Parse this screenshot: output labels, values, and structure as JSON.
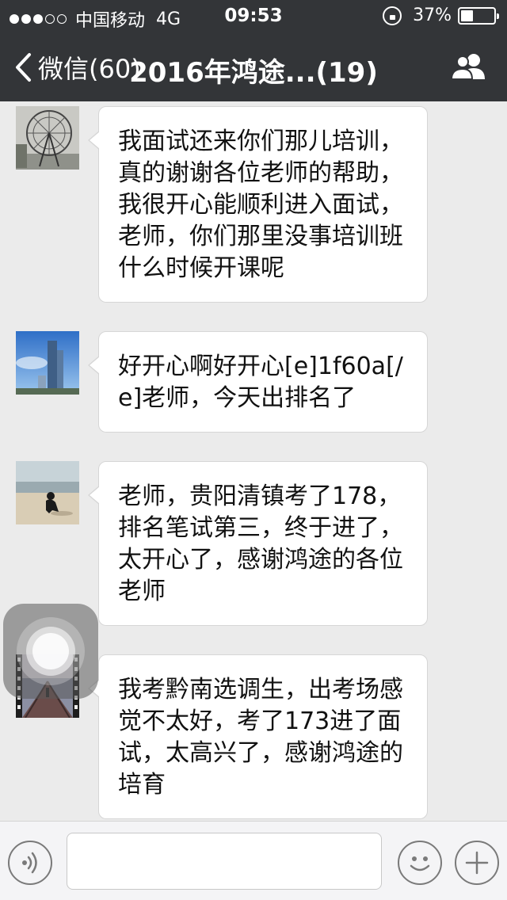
{
  "status_bar": {
    "carrier": "中国移动",
    "network": "4G",
    "time": "09:53",
    "battery": "37%",
    "battery_level": 0.37,
    "signal_bars_filled": 3,
    "signal_bars_total": 5
  },
  "nav": {
    "back_label": "微信(60)",
    "title": "2016年鸿途...(19)",
    "group_info_icon": "people-icon"
  },
  "messages": [
    {
      "avatar": "ferris-wheel-photo",
      "text": "我面试还来你们那儿培训，真的谢谢各位老师的帮助，我很开心能顺利进入面试，老师，你们那里没事培训班什么时候开课呢"
    },
    {
      "avatar": "skyscraper-photo",
      "text": "好开心啊好开心[e]1f60a[/e]老师，今天出排名了"
    },
    {
      "avatar": "beach-person-photo",
      "text": "老师，贵阳清镇考了178，排名笔试第三，终于进了，太开心了，感谢鸿途的各位老师"
    },
    {
      "avatar": "boardwalk-film-photo",
      "text": "我考黔南选调生，出考场感觉不太好，考了173进了面试，太高兴了，感谢鸿途的培育"
    }
  ],
  "input_bar": {
    "voice_icon": "voice-icon",
    "text_value": "",
    "emoji_icon": "emoji-icon",
    "more_icon": "plus-icon"
  },
  "colors": {
    "header_bg": "#333538",
    "chat_bg": "#ebebeb",
    "bubble_bg": "#ffffff"
  }
}
